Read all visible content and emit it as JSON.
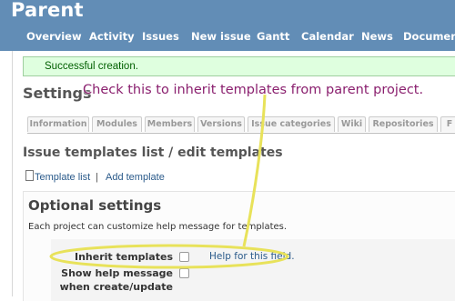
{
  "header": {
    "project_title": "Parent",
    "menu": [
      "Overview",
      "Activity",
      "Issues",
      "New issue",
      "Gantt",
      "Calendar",
      "News",
      "Documents"
    ]
  },
  "flash": {
    "notice": "Successful creation."
  },
  "settings": {
    "heading": "Settings",
    "tabs": [
      "Information",
      "Modules",
      "Members",
      "Versions",
      "Issue categories",
      "Wiki",
      "Repositories",
      "F"
    ]
  },
  "templates": {
    "heading": "Issue templates list / edit templates",
    "template_list_link": "Template list",
    "separator": "|",
    "add_template_link": "Add template"
  },
  "optional": {
    "heading": "Optional settings",
    "description": "Each project can customize help message for templates.",
    "inherit_label": "Inherit templates",
    "inherit_checked": false,
    "help_link": "Help for this field.",
    "show_help_label_line1": "Show help message",
    "show_help_label_line2": "when create/update",
    "show_help_checked": false
  },
  "annotation": {
    "text": "Check this to inherit templates from parent project.",
    "color": "#8a1f6e",
    "highlight_color": "#e8e25a"
  },
  "colors": {
    "header_bg": "#628db6",
    "flash_bg": "#dfffdf",
    "link": "#2a5a8a"
  }
}
